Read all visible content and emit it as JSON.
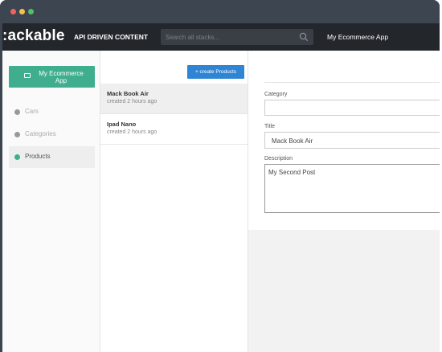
{
  "window": {
    "controls": [
      "close",
      "minimize",
      "maximize"
    ],
    "colors": {
      "close": "#f0655b",
      "minimize": "#f5c04d",
      "maximize": "#52c166"
    }
  },
  "appbar": {
    "logo": ":ackable",
    "subtitle": "API DRIVEN CONTENT",
    "search_placeholder": "Search all stacks...",
    "search_icon": "search-icon",
    "app_name": "My Ecommerce App"
  },
  "sidebar": {
    "primary_button": {
      "label": "My Ecommerce App",
      "icon": "box-icon"
    },
    "items": [
      {
        "label": "Cars",
        "active": false
      },
      {
        "label": "Categories",
        "active": false
      },
      {
        "label": "Products",
        "active": true
      }
    ],
    "accent": "#3fae8e"
  },
  "list": {
    "create_button": "+ create Products",
    "rows": [
      {
        "name": "Mack Book Air",
        "time": "created 2 hours ago",
        "selected": true
      },
      {
        "name": "Ipad Nano",
        "time": "created 2 hours ago",
        "selected": false
      }
    ]
  },
  "editor": {
    "fields": {
      "category": {
        "label": "Category",
        "value": ""
      },
      "title": {
        "label": "Title",
        "value": "Mack Book Air"
      },
      "description": {
        "label": "Description",
        "value": "My Second Post"
      }
    }
  }
}
